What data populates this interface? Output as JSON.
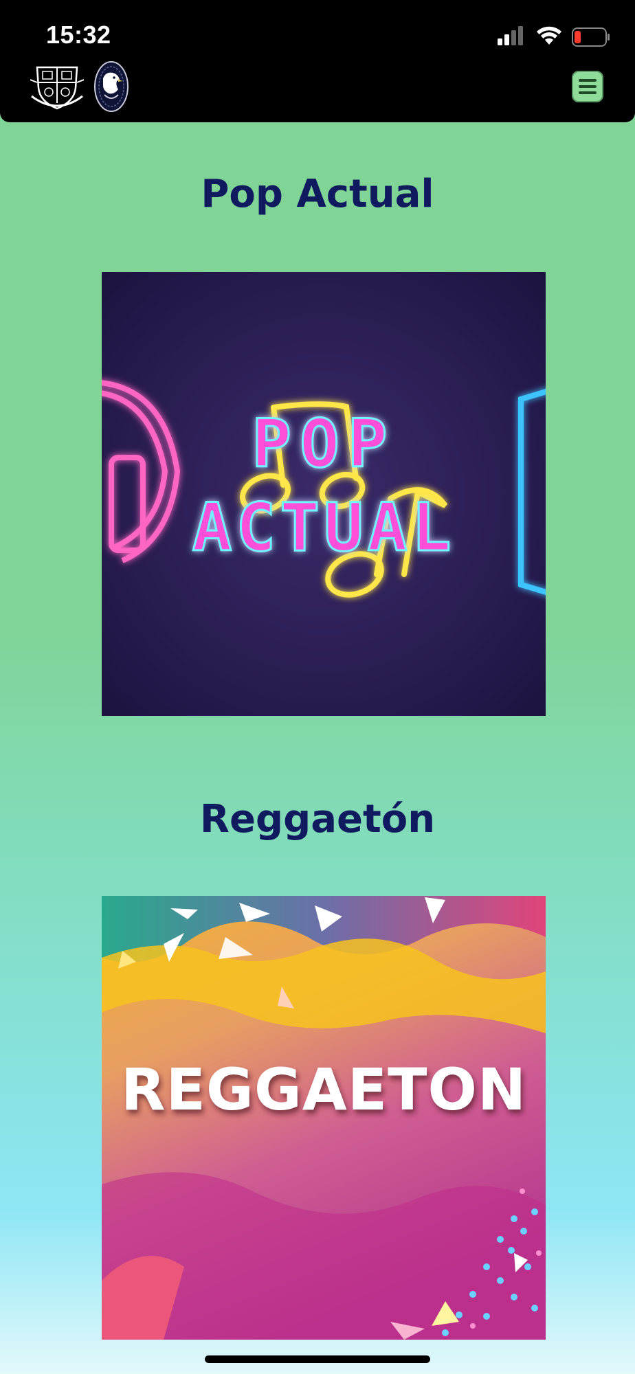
{
  "status_bar": {
    "time": "15:32"
  },
  "header": {
    "logo_left_icon": "school-crest-icon",
    "logo_right_icon": "eagle-emblem-icon",
    "menu_icon": "hamburger-menu-icon"
  },
  "sections": [
    {
      "title": "Pop Actual",
      "cover_text_lines": [
        "POP",
        "ACTUAL"
      ]
    },
    {
      "title": "Reggaetón",
      "cover_text": "REGGAETON"
    }
  ],
  "colors": {
    "title": "#101a5e",
    "page_green": "#80d496",
    "menu_button": "#8fdc9a"
  }
}
